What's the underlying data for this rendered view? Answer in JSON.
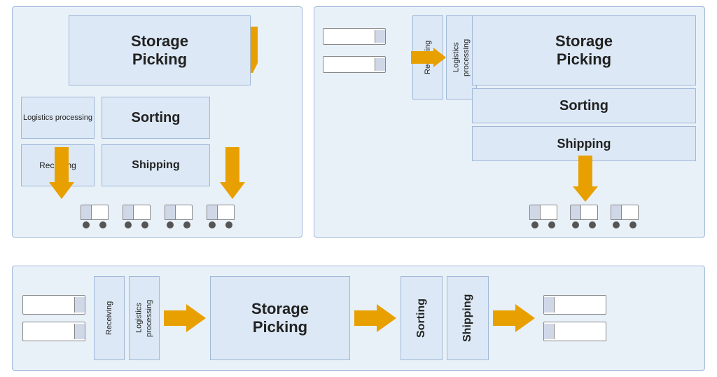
{
  "diagrams": {
    "diagram1": {
      "label": "diagram-top-left",
      "storage_picking": "Storage\nPicking",
      "logistics_processing": "Logistics\nprocessing",
      "sorting": "Sorting",
      "receiving": "Receiving",
      "shipping": "Shipping"
    },
    "diagram2": {
      "label": "diagram-top-right",
      "receiving": "Receiving",
      "logistics_processing": "Logistics\nprocessing",
      "storage_picking": "Storage\nPicking",
      "sorting": "Sorting",
      "shipping": "Shipping"
    },
    "diagram3": {
      "label": "diagram-bottom",
      "receiving": "Receiving",
      "logistics_processing": "Logistics\nprocessing",
      "storage_picking": "Storage\nPicking",
      "sorting": "Sorting",
      "shipping": "Shipping"
    }
  }
}
